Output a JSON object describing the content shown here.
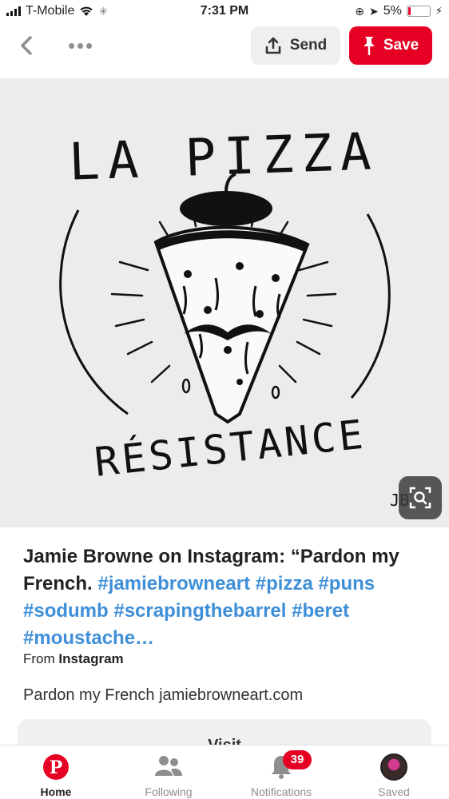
{
  "status_bar": {
    "carrier": "T-Mobile",
    "time": "7:31 PM",
    "battery_percent": "5%"
  },
  "nav": {
    "send_label": "Send",
    "save_label": "Save"
  },
  "pin": {
    "image_text_top": "LA PIZZA",
    "image_text_bottom": "RÉSISTANCE",
    "image_signature": "JB",
    "title_prefix": "Jamie Browne on Instagram: “Pardon my French.",
    "title_tags": "#jamiebrowneart #pizza #puns #sodumb #scrapingthebarrel #beret #moustache…",
    "source_prefix": "From",
    "source_name": "Instagram",
    "description": "Pardon my French jamiebrowneart.com",
    "visit_label": "Visit"
  },
  "tabs": [
    {
      "label": "Home",
      "icon": "pinterest-logo-icon",
      "active": true
    },
    {
      "label": "Following",
      "icon": "people-icon",
      "active": false
    },
    {
      "label": "Notifications",
      "icon": "bell-icon",
      "badge": "39",
      "active": false
    },
    {
      "label": "Saved",
      "icon": "avatar",
      "active": false
    }
  ],
  "colors": {
    "brand_red": "#e60023",
    "hashtag_blue": "#3f8fd8"
  }
}
